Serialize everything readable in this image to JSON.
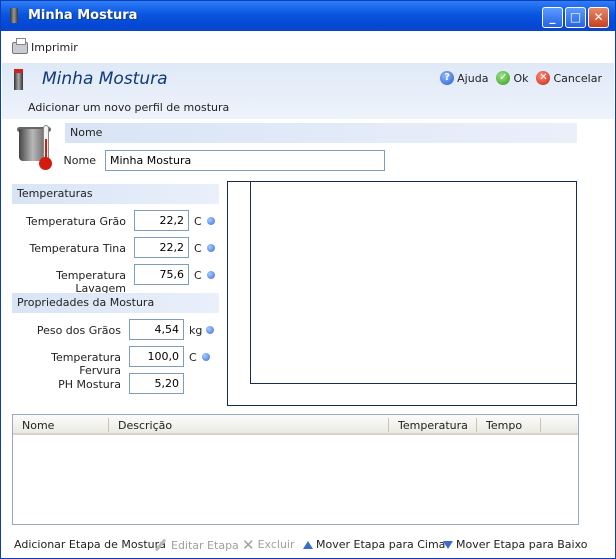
{
  "window": {
    "title": "Minha Mostura",
    "controls": {
      "minimize": "_",
      "maximize": "□",
      "close": "✕"
    }
  },
  "toolbar": {
    "print_label": "Imprimir"
  },
  "header": {
    "title": "Minha Mostura",
    "subtitle": "Adicionar um novo perfil de mostura",
    "help_label": "Ajuda",
    "ok_label": "Ok",
    "cancel_label": "Cancelar",
    "help_icon_glyph": "?",
    "ok_icon_glyph": "✓",
    "cancel_icon_glyph": "✕"
  },
  "name_section": {
    "title": "Nome",
    "name_label": "Nome",
    "name_value": "Minha Mostura"
  },
  "temperatures": {
    "title": "Temperaturas",
    "rows": [
      {
        "label": "Temperatura Grão",
        "value": "22,2",
        "unit": "C"
      },
      {
        "label": "Temperatura Tina",
        "value": "22,2",
        "unit": "C"
      },
      {
        "label": "Temperatura Lavagem",
        "value": "75,6",
        "unit": "C"
      }
    ]
  },
  "properties": {
    "title": "Propriedades da Mostura",
    "rows": [
      {
        "label": "Peso dos Grãos",
        "value": "4,54",
        "unit": "kg"
      },
      {
        "label": "Temperatura Fervura",
        "value": "100,0",
        "unit": "C"
      },
      {
        "label": "PH Mostura",
        "value": "5,20",
        "unit": ""
      }
    ]
  },
  "steps_table": {
    "columns": [
      "Nome",
      "Descrição",
      "Temperatura",
      "Tempo"
    ],
    "rows": []
  },
  "bottom_actions": {
    "add": "Adicionar Etapa de Mostura",
    "edit": "Editar Etapa",
    "delete": "Excluir",
    "move_up": "Mover Etapa para Cima",
    "move_down": "Mover Etapa para Baixo"
  },
  "colors": {
    "titlebar": "#0a55e0",
    "section_bar": "#d8e4f5",
    "accent": "#3672d8"
  }
}
